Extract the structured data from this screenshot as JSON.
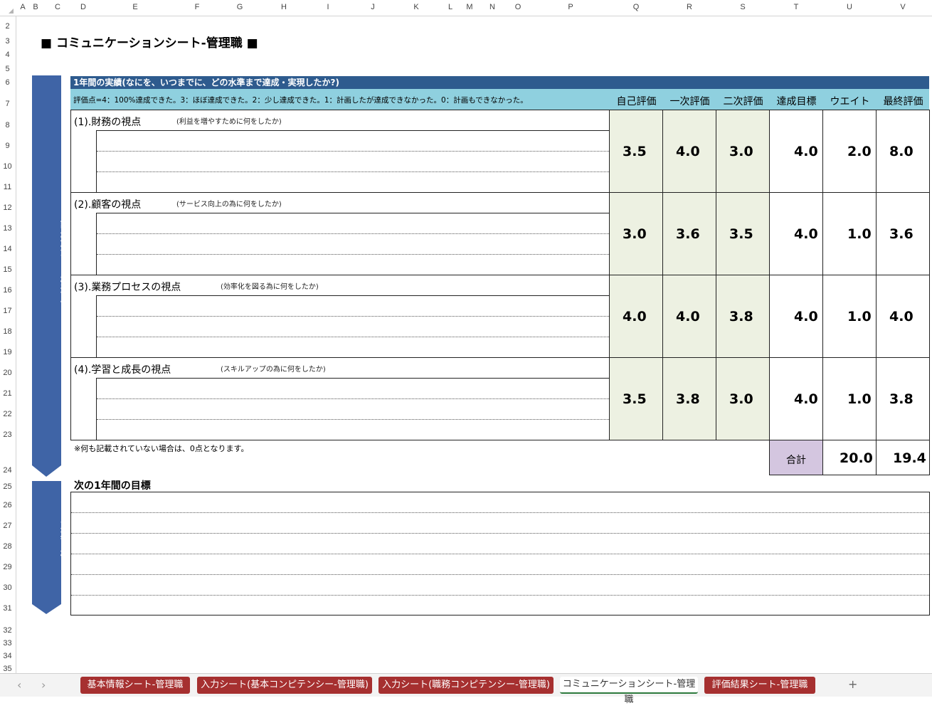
{
  "sheet": {
    "columns": [
      "A",
      "B",
      "C",
      "D",
      "E",
      "F",
      "G",
      "H",
      "I",
      "J",
      "K",
      "L",
      "M",
      "N",
      "O",
      "P",
      "Q",
      "R",
      "S",
      "T",
      "U",
      "V"
    ],
    "rows": [
      "2",
      "3",
      "4",
      "5",
      "6",
      "7",
      "8",
      "9",
      "10",
      "11",
      "12",
      "13",
      "14",
      "15",
      "16",
      "17",
      "18",
      "19",
      "20",
      "21",
      "22",
      "23",
      "24",
      "25",
      "26",
      "27",
      "28",
      "29",
      "30",
      "31",
      "32",
      "33",
      "34",
      "35"
    ]
  },
  "title": "■ コミュニケーションシート-管理職 ■",
  "section1": {
    "ribbon_label": "課題解決・目標達成",
    "header": "1年間の実績(なにを、いつまでに、どの水準まで達成・実現したか?)",
    "scale_note": "評価点=4：100%達成できた。3：ほぼ達成できた。2：少し達成できた。1：計画したが達成できなかった。0：計画もできなかった。",
    "columns": [
      "自己評価",
      "一次評価",
      "二次評価",
      "達成目標",
      "ウエイト",
      "最終評価"
    ],
    "rows": [
      {
        "label": "(1).財務の視点",
        "hint": "(利益を増やすために何をしたか)",
        "self": "3.5",
        "first": "4.0",
        "second": "3.0",
        "target": "4.0",
        "weight": "2.0",
        "final": "8.0"
      },
      {
        "label": "(2).顧客の視点",
        "hint": "(サービス向上の為に何をしたか)",
        "self": "3.0",
        "first": "3.6",
        "second": "3.5",
        "target": "4.0",
        "weight": "1.0",
        "final": "3.6"
      },
      {
        "label": "(3).業務プロセスの視点",
        "hint": "(効率化を図る為に何をしたか)",
        "self": "4.0",
        "first": "4.0",
        "second": "3.8",
        "target": "4.0",
        "weight": "1.0",
        "final": "4.0"
      },
      {
        "label": "(4).学習と成長の視点",
        "hint": "(スキルアップの為に何をしたか)",
        "self": "3.5",
        "first": "3.8",
        "second": "3.0",
        "target": "4.0",
        "weight": "1.0",
        "final": "3.8"
      }
    ],
    "footnote": "※何も記載されていない場合は、0点となります。",
    "total_label": "合計",
    "total_weight": "20.0",
    "total_final": "19.4"
  },
  "section2": {
    "ribbon_label": "次期目標",
    "header": "次の1年間の目標"
  },
  "tabs": [
    {
      "label": "基本情報シート-管理職",
      "active": false
    },
    {
      "label": "入力シート(基本コンピテンシー-管理職)",
      "active": false
    },
    {
      "label": "入力シート(職務コンピテンシー-管理職)",
      "active": false
    },
    {
      "label": "コミュニケーションシート-管理職",
      "active": true
    },
    {
      "label": "評価結果シート-管理職",
      "active": false
    }
  ],
  "tab_add": "+",
  "colors": {
    "ribbon": "#3f64a6",
    "header_dark": "#2e5b8e",
    "header_light": "#8fd0df",
    "eval_fill": "#edf1e2",
    "total_fill": "#d4c6e0",
    "tab": "#a63030"
  }
}
